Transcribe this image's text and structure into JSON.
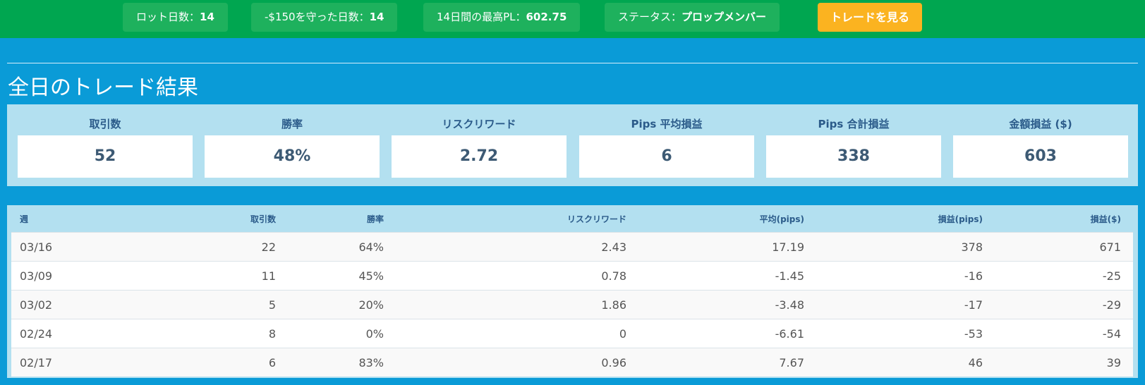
{
  "topbar": {
    "items": [
      {
        "label": "ロット日数：",
        "value": "14"
      },
      {
        "label": "-$150を守った日数：",
        "value": "14"
      },
      {
        "label": "14日間の最高PL：",
        "value": "602.75"
      },
      {
        "label": "ステータス：",
        "value": "プロップメンバー"
      }
    ],
    "cta_label": "トレードを見る"
  },
  "section": {
    "title": "全日のトレード結果"
  },
  "stats": [
    {
      "label": "取引数",
      "value": "52"
    },
    {
      "label": "勝率",
      "value": "48%"
    },
    {
      "label": "リスクリワード",
      "value": "2.72"
    },
    {
      "label": "Pips 平均損益",
      "value": "6"
    },
    {
      "label": "Pips 合計損益",
      "value": "338"
    },
    {
      "label": "金額損益 ($)",
      "value": "603"
    }
  ],
  "table": {
    "headers": [
      "週",
      "取引数",
      "勝率",
      "リスクリワード",
      "平均(pips)",
      "損益(pips)",
      "損益($)"
    ],
    "rows": [
      [
        "03/16",
        "22",
        "64%",
        "2.43",
        "17.19",
        "378",
        "671"
      ],
      [
        "03/09",
        "11",
        "45%",
        "0.78",
        "-1.45",
        "-16",
        "-25"
      ],
      [
        "03/02",
        "5",
        "20%",
        "1.86",
        "-3.48",
        "-17",
        "-29"
      ],
      [
        "02/24",
        "8",
        "0%",
        "0",
        "-6.61",
        "-53",
        "-54"
      ],
      [
        "02/17",
        "6",
        "83%",
        "0.96",
        "7.67",
        "46",
        "39"
      ]
    ]
  },
  "colors": {
    "topbar_bg": "#00a650",
    "pill_bg": "#1eb15d",
    "cta_bg": "#fbb320",
    "page_bg": "#0a9bd7",
    "panel_bg": "#b3e0f0",
    "label_text": "#2b5b8a"
  }
}
